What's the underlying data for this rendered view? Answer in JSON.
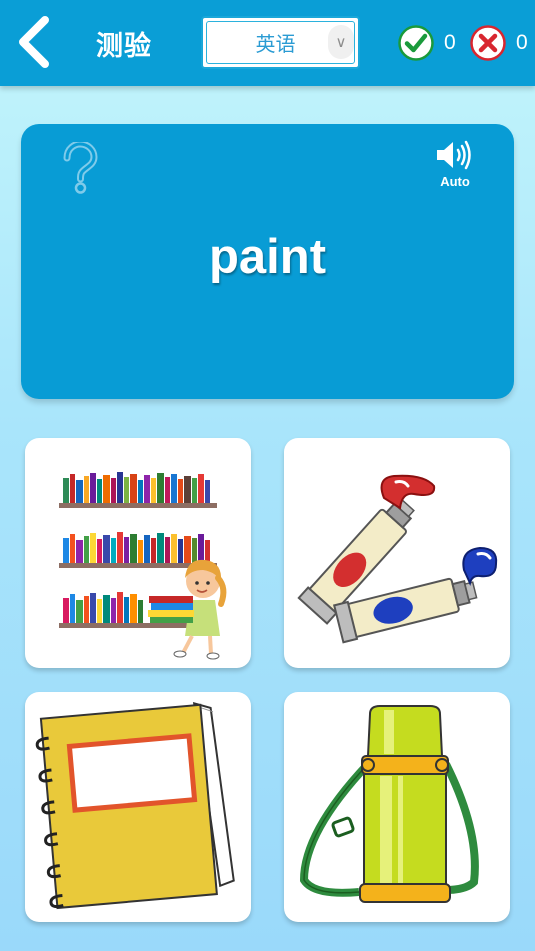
{
  "header": {
    "title": "测验",
    "language_selected": "英语",
    "correct_count": "0",
    "wrong_count": "0"
  },
  "word_card": {
    "word": "paint",
    "audio_label": "Auto"
  },
  "choices": [
    {
      "picture": "bookshelf-with-girl"
    },
    {
      "picture": "paint-tubes"
    },
    {
      "picture": "notebook"
    },
    {
      "picture": "thermos-flask"
    }
  ],
  "colors": {
    "header_bg": "#0a9ed6",
    "card_bg": "#089cd5",
    "correct": "#1a9a3b",
    "wrong": "#d8262f"
  },
  "icons": [
    "back-arrow-icon",
    "check-icon",
    "cross-icon",
    "question-icon",
    "speaker-icon"
  ]
}
